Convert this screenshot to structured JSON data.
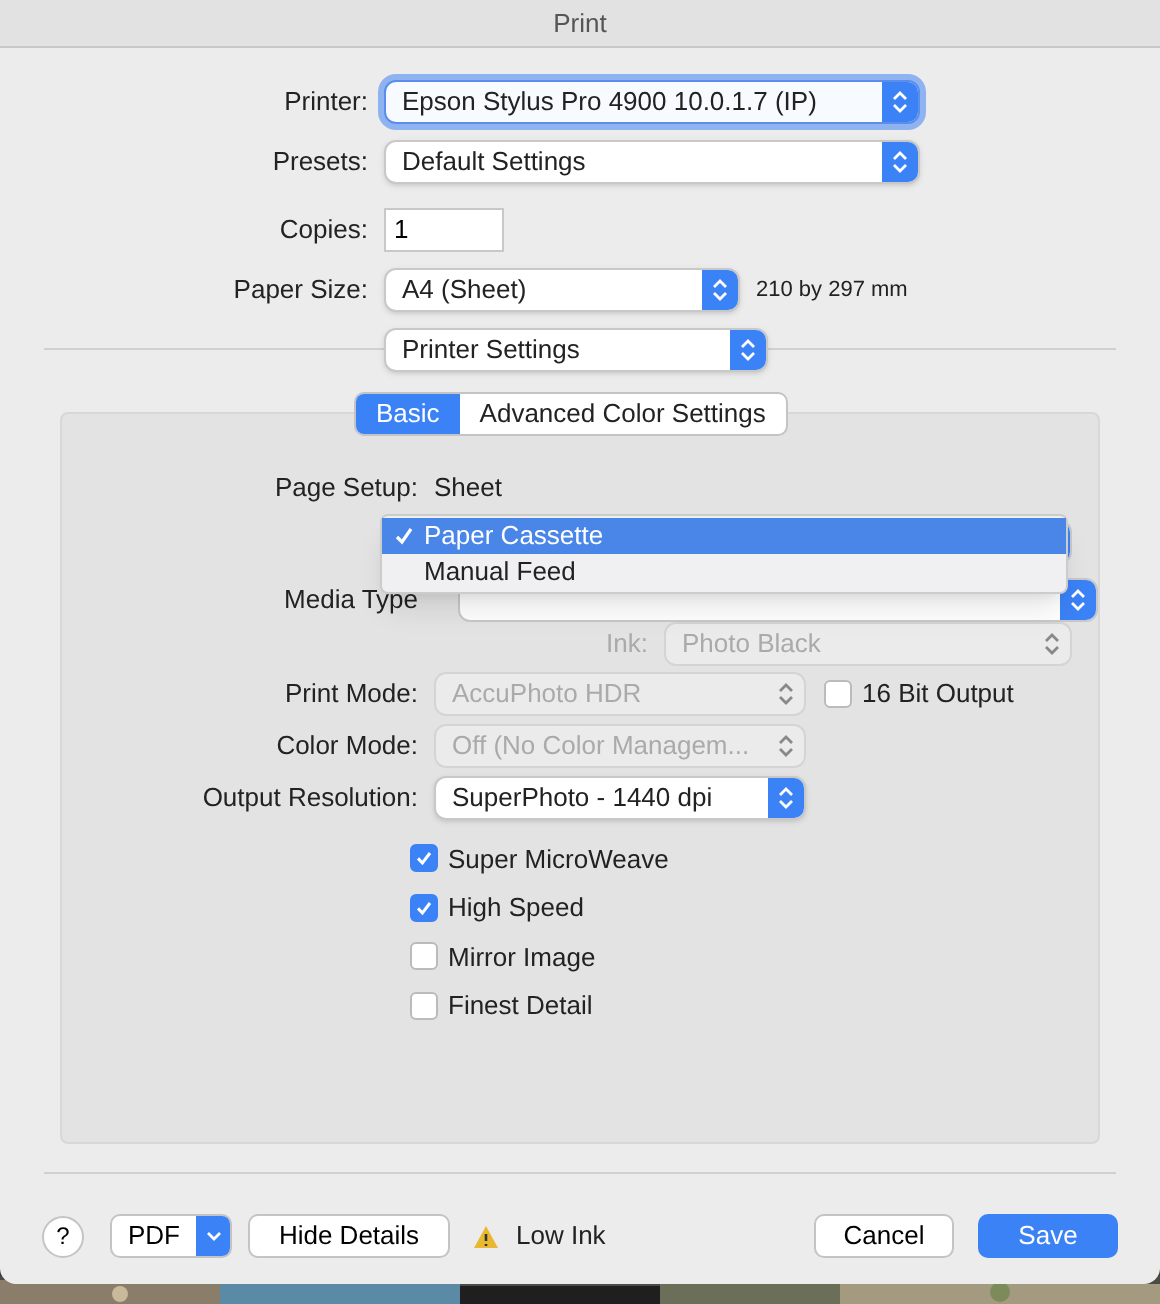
{
  "window": {
    "title": "Print"
  },
  "fields": [
    {
      "label": "Printer:",
      "kind": "popup",
      "value": "Epson Stylus Pro 4900 10.0.1.7 (IP)",
      "focused": true
    },
    {
      "label": "Presets:",
      "kind": "popup",
      "value": "Default Settings",
      "focused": false
    },
    {
      "label": "Copies:",
      "kind": "text",
      "value": "1"
    },
    {
      "label": "Paper Size:",
      "kind": "popup",
      "value": "A4 (Sheet)",
      "note": "210 by 297 mm",
      "focused": false
    }
  ],
  "section_popup": {
    "value": "Printer Settings"
  },
  "tabs": [
    {
      "label": "Basic",
      "selected": true
    },
    {
      "label": "Advanced Color Settings",
      "selected": false
    }
  ],
  "page_setup": {
    "label": "Page Setup:",
    "value": "Sheet"
  },
  "source_menu": {
    "items": [
      {
        "label": "Paper Cassette",
        "selected": true
      },
      {
        "label": "Manual Feed",
        "selected": false
      }
    ]
  },
  "media_type": {
    "label": "Media Type"
  },
  "ink": {
    "label": "Ink:",
    "value": "Photo Black",
    "disabled": true
  },
  "settings": [
    {
      "label": "Print Mode:",
      "value": "AccuPhoto HDR",
      "disabled": true,
      "checkbox": {
        "label": "16 Bit Output",
        "checked": false
      }
    },
    {
      "label": "Color Mode:",
      "value": "Off (No Color Managem...",
      "disabled": true
    },
    {
      "label": "Output Resolution:",
      "value": "SuperPhoto - 1440 dpi",
      "disabled": false
    }
  ],
  "options": [
    {
      "label": "Super MicroWeave",
      "checked": true
    },
    {
      "label": "High Speed",
      "checked": true
    },
    {
      "label": "Mirror Image",
      "checked": false
    },
    {
      "label": "Finest Detail",
      "checked": false
    }
  ],
  "footer": {
    "help": "?",
    "pdf": "PDF",
    "hide_details": "Hide Details",
    "warning": "Low Ink",
    "cancel": "Cancel",
    "save": "Save"
  }
}
